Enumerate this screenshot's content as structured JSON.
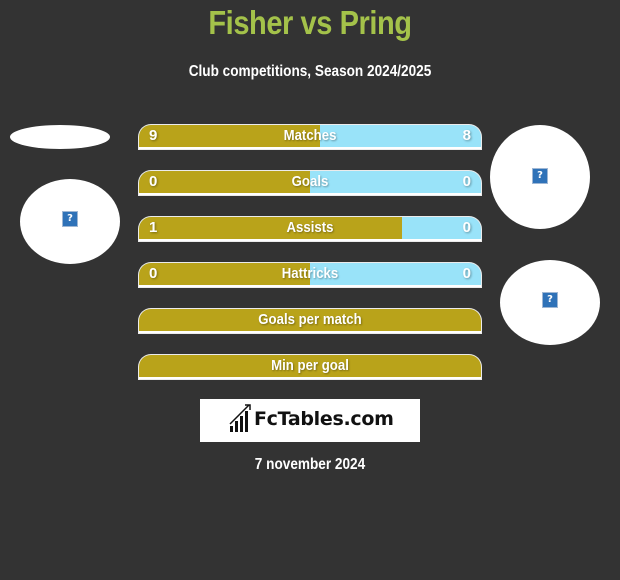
{
  "header": {
    "title": "Fisher vs Pring",
    "subtitle": "Club competitions, Season 2024/2025"
  },
  "players": {
    "left": "Fisher",
    "right": "Pring"
  },
  "stats": [
    {
      "label": "Matches",
      "left": "9",
      "right": "8",
      "left_share": 0.53
    },
    {
      "label": "Goals",
      "left": "0",
      "right": "0",
      "left_share": 0.5
    },
    {
      "label": "Assists",
      "left": "1",
      "right": "0",
      "left_share": 0.77
    },
    {
      "label": "Hattricks",
      "left": "0",
      "right": "0",
      "left_share": 0.5
    },
    {
      "label": "Goals per match"
    },
    {
      "label": "Min per goal"
    }
  ],
  "colors": {
    "title": "#a4c24a",
    "left_bar": "#b9a31a",
    "right_bar": "#99e3f9",
    "background": "#333333"
  },
  "icons": {
    "placeholder": "?"
  },
  "brand": {
    "name": "FcTables.com"
  },
  "footer": {
    "date": "7 november 2024"
  }
}
